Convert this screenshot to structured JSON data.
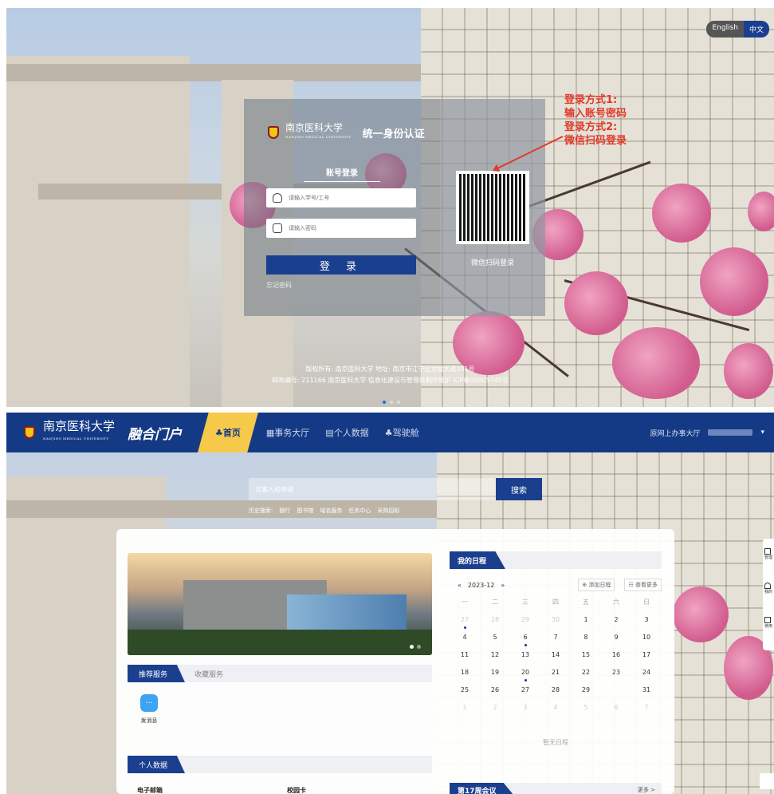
{
  "login_page": {
    "lang": {
      "english": "English",
      "chinese": "中文"
    },
    "university_name": "南京医科大学",
    "university_en": "NANJING MEDICAL UNIVERSITY",
    "title": "统一身份认证",
    "tab": "账号登录",
    "username_placeholder": "请输入学号/工号",
    "password_placeholder": "请输入密码",
    "login_button": "登 录",
    "forgot": "忘记密码",
    "qr_label": "微信扫码登录",
    "annotation": [
      "登录方式1:",
      "输入账号密码",
      "登录方式2:",
      "微信扫码登录"
    ],
    "footer": [
      "版权所有: 南京医科大学 地址: 南京市江宁区龙眠大道101号",
      "邮政编号: 211166 南京医科大学 信息化建设与管理处制作维护 ICP备05005745号"
    ]
  },
  "portal": {
    "university_name": "南京医科大学",
    "university_en": "NANJING MEDICAL UNIVERSITY",
    "portal_name": "融合门户",
    "nav": [
      {
        "label": "首页",
        "icon": "user-icon"
      },
      {
        "label": "事务大厅",
        "icon": "grid-icon"
      },
      {
        "label": "个人数据",
        "icon": "doc-icon"
      },
      {
        "label": "驾驶舱",
        "icon": "org-icon"
      }
    ],
    "nav_right": "原网上办事大厅",
    "search_value": "访客入校申请",
    "search_button": "搜索",
    "history_label": "历史搜索:",
    "history": [
      "银行",
      "图书馆",
      "域名服务",
      "任务中心",
      "采购招标"
    ],
    "services_tabs": {
      "active": "推荐服务",
      "inactive": "收藏服务"
    },
    "service_item": "发消息",
    "personal_data": "个人数据",
    "cards": [
      "电子邮箱",
      "校园卡"
    ],
    "calendar": {
      "title": "我的日程",
      "month": "2023-12",
      "prev": "«",
      "next": "»",
      "add": "⊕ 添加日程",
      "more": "☷ 查看更多",
      "weekdays": [
        "一",
        "二",
        "三",
        "四",
        "五",
        "六",
        "日"
      ],
      "no_event": "暂无日程"
    },
    "meeting_title": "第17周会议",
    "meeting_more": "更多 >",
    "side": [
      "管理",
      "我的",
      "使用"
    ]
  }
}
